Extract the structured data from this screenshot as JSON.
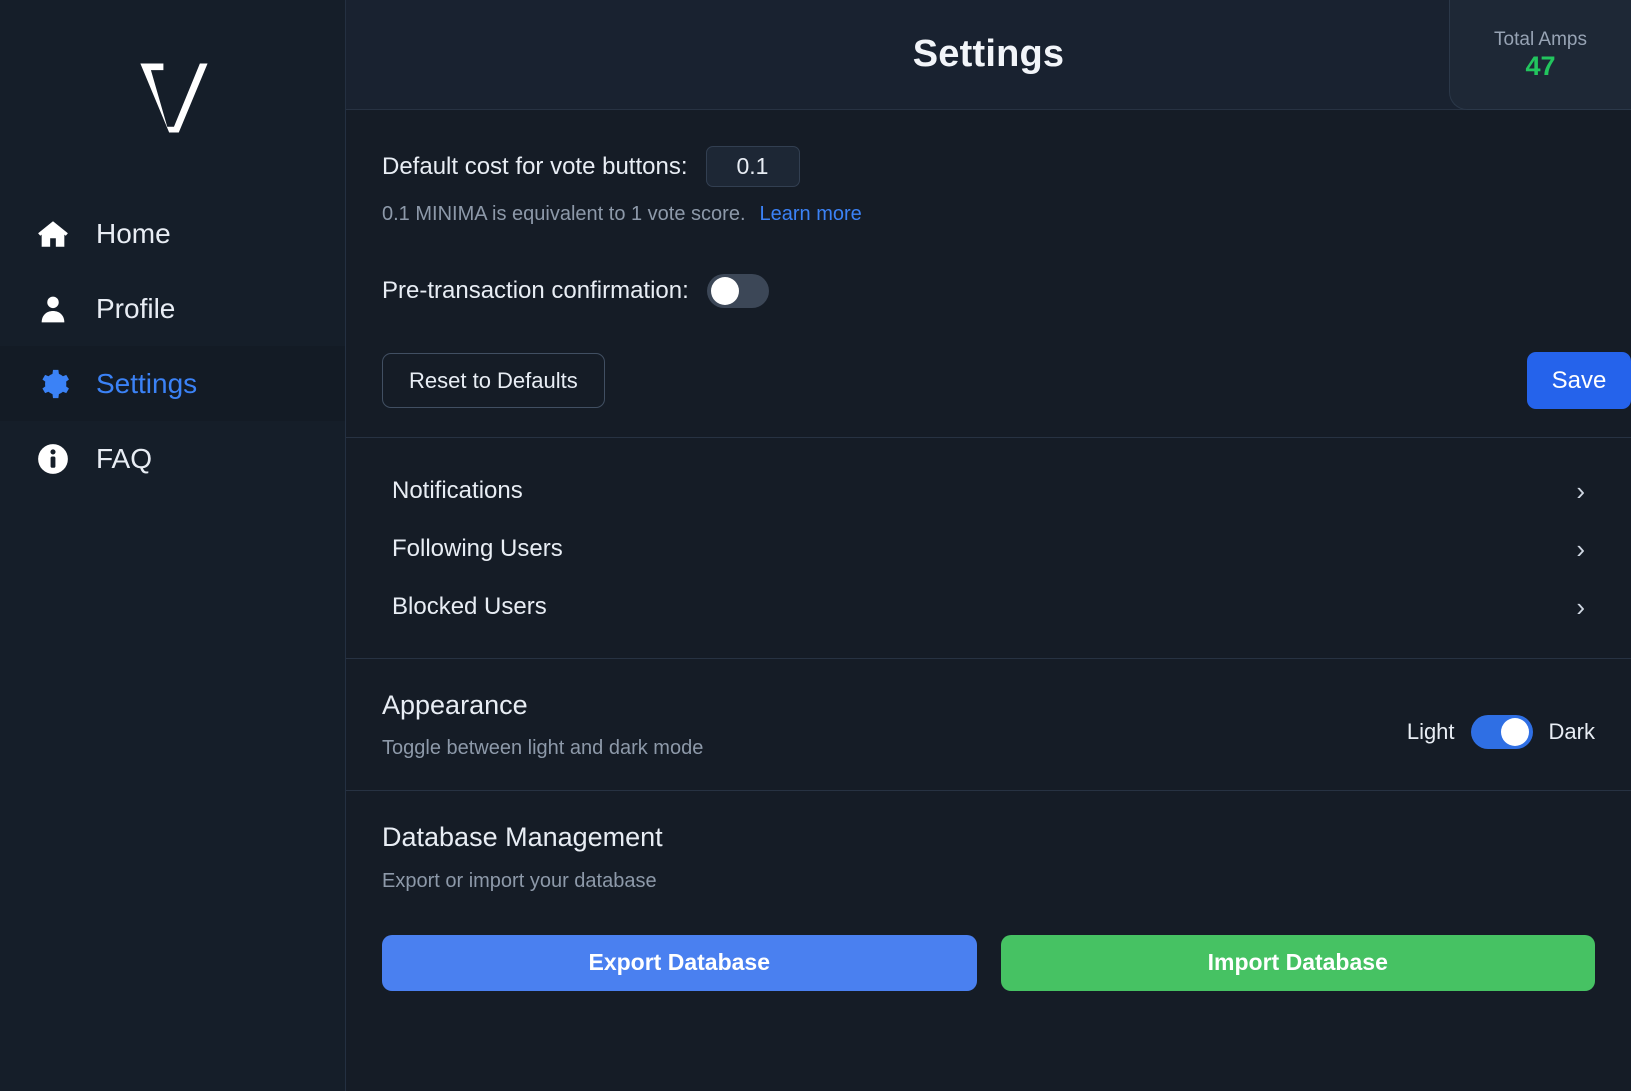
{
  "sidebar": {
    "logo_name": "logo-v",
    "items": [
      {
        "label": "Home",
        "icon": "home-icon",
        "active": false
      },
      {
        "label": "Profile",
        "icon": "user-icon",
        "active": false
      },
      {
        "label": "Settings",
        "icon": "gear-icon",
        "active": true
      },
      {
        "label": "FAQ",
        "icon": "info-icon",
        "active": false
      }
    ]
  },
  "header": {
    "title": "Settings",
    "amps_label": "Total Amps",
    "amps_value": "47",
    "amps_color": "#22c55e"
  },
  "preferences": {
    "cost_label": "Default cost for vote buttons:",
    "cost_value": "0.1",
    "cost_placeholder": "0.1",
    "helper_text": "0.1 MINIMA is equivalent to 1 vote score.",
    "learn_more_label": "Learn more",
    "confirmation_label": "Pre-transaction confirmation:",
    "confirmation_on": false,
    "reset_label": "Reset to Defaults",
    "save_label": "Save",
    "save_color": "#2563eb",
    "link_color": "#3b82f6"
  },
  "links": [
    {
      "label": "Notifications",
      "chevron": "›"
    },
    {
      "label": "Following Users",
      "chevron": "›"
    },
    {
      "label": "Blocked Users",
      "chevron": "›"
    }
  ],
  "appearance": {
    "title": "Appearance",
    "subtitle": "Toggle between light and dark mode",
    "light_label": "Light",
    "dark_label": "Dark",
    "dark_mode_on": true,
    "toggle_color": "#2f6fe4"
  },
  "database": {
    "title": "Database Management",
    "subtitle": "Export or import your database",
    "export_label": "Export Database",
    "import_label": "Import Database",
    "export_color": "#4a80f0",
    "import_color": "#46c263"
  }
}
